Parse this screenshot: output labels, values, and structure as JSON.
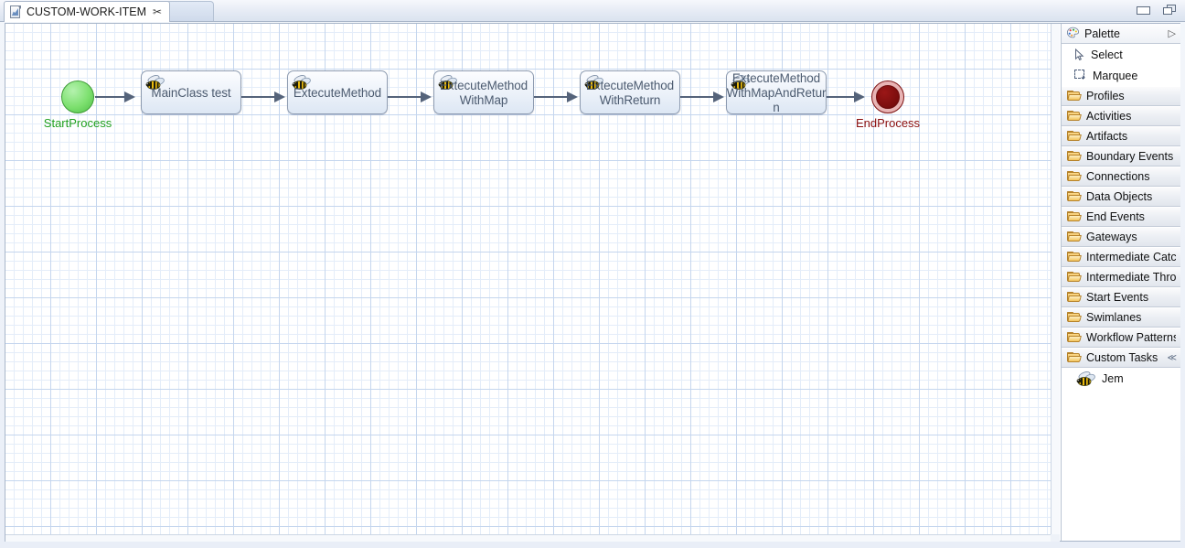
{
  "window": {
    "tab_title": "CUSTOM-WORK-ITEM",
    "tab_icon": "bpmn-file-icon",
    "close_glyph": "✂",
    "minimize_label": "Minimize",
    "restore_label": "Restore"
  },
  "diagram": {
    "start_event": {
      "name": "StartProcess",
      "label_color": "#20a020"
    },
    "end_event": {
      "name": "EndProcess",
      "label_color": "#8b0f0f"
    },
    "nodes": [
      {
        "id": "n1",
        "label": "MainClass test",
        "icon": "bee-icon"
      },
      {
        "id": "n2",
        "label": "ExtecuteMethod",
        "icon": "bee-icon"
      },
      {
        "id": "n3",
        "label": "ExtecuteMethod\nWithMap",
        "icon": "bee-icon"
      },
      {
        "id": "n4",
        "label": "ExtecuteMethod\nWithReturn",
        "icon": "bee-icon"
      },
      {
        "id": "n5",
        "label": "ExtecuteMethod\nWithMapAndRetur\nn",
        "icon": "bee-icon"
      }
    ],
    "connections": 6,
    "colors": {
      "node_border": "#8d9bb0",
      "node_text": "#4c5b70",
      "connector": "#55637a",
      "grid_major": "#c5d6ee",
      "grid_minor": "#e4edf9"
    }
  },
  "palette": {
    "header": {
      "title": "Palette",
      "icon": "palette-icon",
      "chevron": "▷"
    },
    "tools": [
      {
        "label": "Select",
        "icon": "cursor-icon"
      },
      {
        "label": "Marquee",
        "icon": "marquee-icon"
      }
    ],
    "drawers": [
      {
        "label": "Profiles",
        "icon": "folder-icon"
      },
      {
        "label": "Activities",
        "icon": "folder-icon"
      },
      {
        "label": "Artifacts",
        "icon": "folder-icon"
      },
      {
        "label": "Boundary Events",
        "icon": "folder-icon"
      },
      {
        "label": "Connections",
        "icon": "folder-icon"
      },
      {
        "label": "Data Objects",
        "icon": "folder-icon"
      },
      {
        "label": "End Events",
        "icon": "folder-icon"
      },
      {
        "label": "Gateways",
        "icon": "folder-icon"
      },
      {
        "label": "Intermediate Catc...",
        "icon": "folder-icon"
      },
      {
        "label": "Intermediate Thro...",
        "icon": "folder-icon"
      },
      {
        "label": "Start Events",
        "icon": "folder-icon"
      },
      {
        "label": "Swimlanes",
        "icon": "folder-icon"
      },
      {
        "label": "Workflow Patterns",
        "icon": "folder-icon"
      }
    ],
    "expanded_drawer": {
      "label": "Custom Tasks",
      "icon": "folder-icon",
      "pin": "≪"
    },
    "expanded_items": [
      {
        "label": "Jem",
        "icon": "bee-icon"
      }
    ]
  }
}
